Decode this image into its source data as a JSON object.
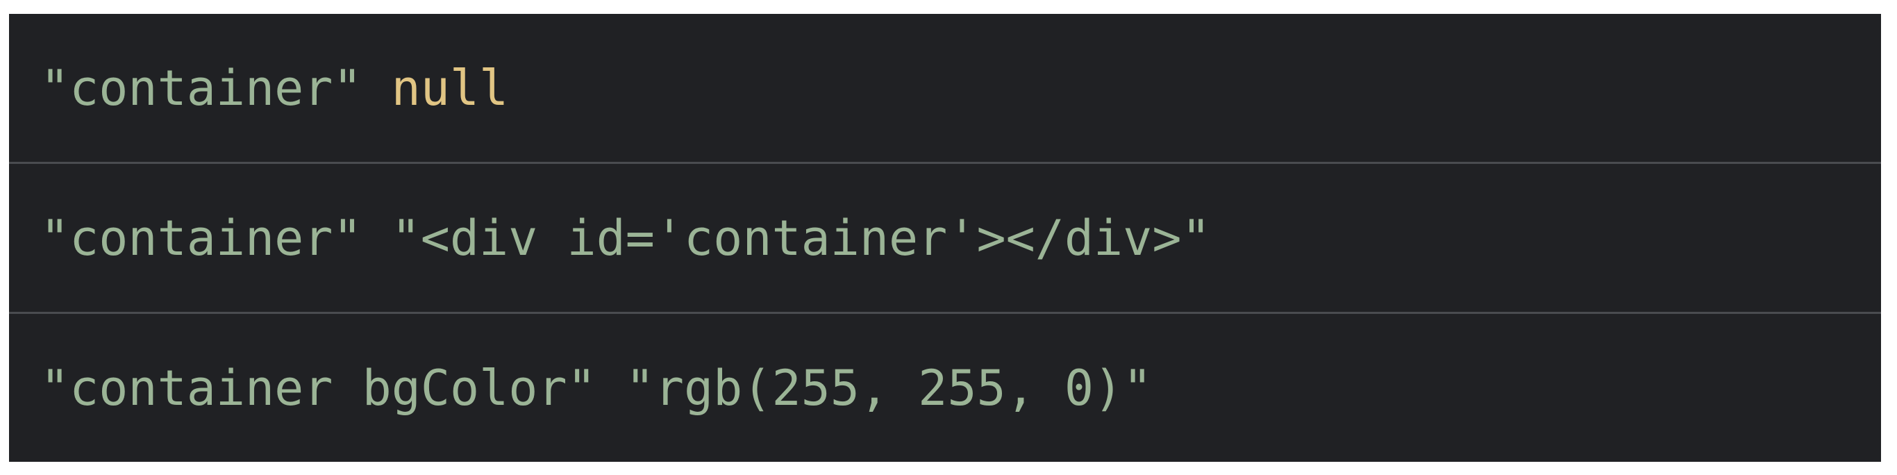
{
  "console": {
    "rows": [
      {
        "label": "\"container\"",
        "value": "null",
        "value_type": "null"
      },
      {
        "label": "\"container\"",
        "value": "\"<div id='container'></div>\"",
        "value_type": "string"
      },
      {
        "label": "\"container bgColor\"",
        "value": "\"rgb(255, 255, 0)\"",
        "value_type": "string"
      }
    ]
  },
  "colors": {
    "background": "#202124",
    "string": "#9bb496",
    "null": "#e1c584",
    "divider": "#4a4c50"
  }
}
